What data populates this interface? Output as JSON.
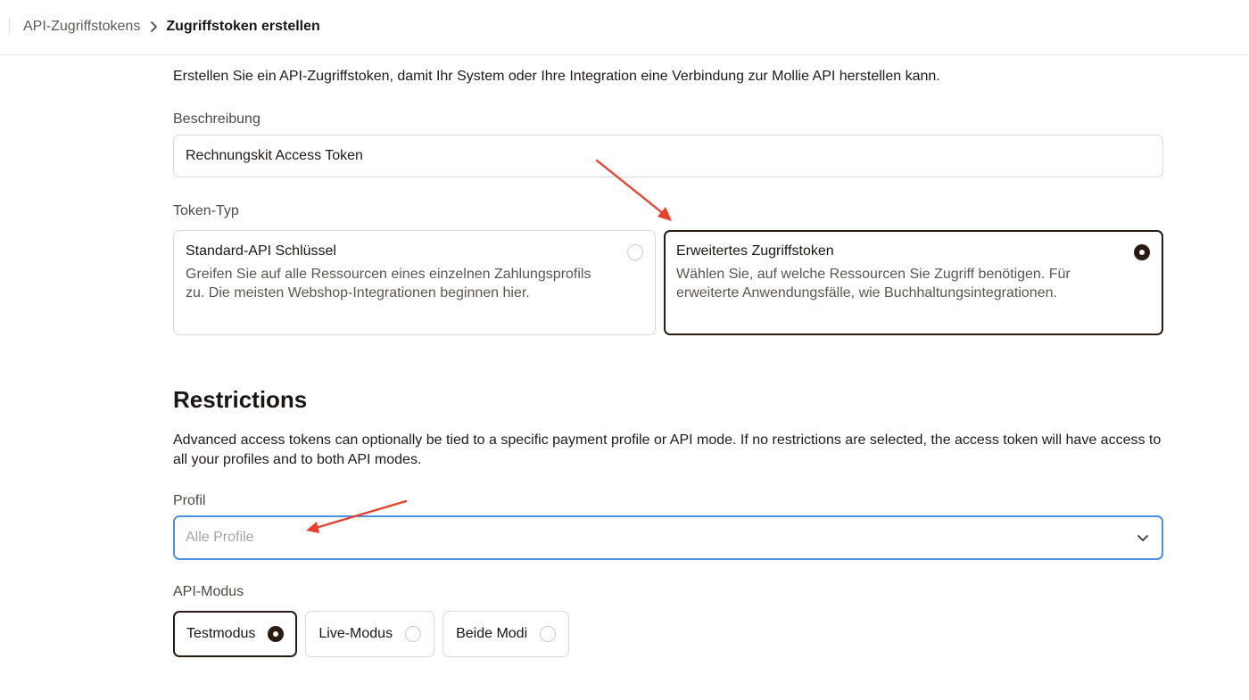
{
  "breadcrumb": {
    "parent": "API-Zugriffstokens",
    "current": "Zugriffstoken erstellen"
  },
  "intro": "Erstellen Sie ein API-Zugriffstoken, damit Ihr System oder Ihre Integration eine Verbindung zur Mollie API herstellen kann.",
  "description": {
    "label": "Beschreibung",
    "value": "Rechnungskit Access Token"
  },
  "token_type": {
    "label": "Token-Typ",
    "options": [
      {
        "title": "Standard-API Schlüssel",
        "description": "Greifen Sie auf alle Ressourcen eines einzelnen Zahlungsprofils zu. Die meisten Webshop-Integrationen beginnen hier.",
        "selected": false
      },
      {
        "title": "Erweitertes Zugriffstoken",
        "description": "Wählen Sie, auf welche Ressourcen Sie Zugriff benötigen. Für erweiterte Anwendungsfälle, wie Buchhaltungsintegrationen.",
        "selected": true
      }
    ]
  },
  "restrictions": {
    "heading": "Restrictions",
    "text": "Advanced access tokens can optionally be tied to a specific payment profile or API mode. If no restrictions are selected, the access token will have access to all your profiles and to both API modes."
  },
  "profile": {
    "label": "Profil",
    "placeholder": "Alle Profile"
  },
  "api_mode": {
    "label": "API-Modus",
    "options": [
      {
        "label": "Testmodus",
        "selected": true
      },
      {
        "label": "Live-Modus",
        "selected": false
      },
      {
        "label": "Beide Modi",
        "selected": false
      }
    ]
  },
  "colors": {
    "accent_dark": "#2b1a12",
    "focus_blue": "#4a90e2",
    "annotation_red": "#e8412c"
  }
}
